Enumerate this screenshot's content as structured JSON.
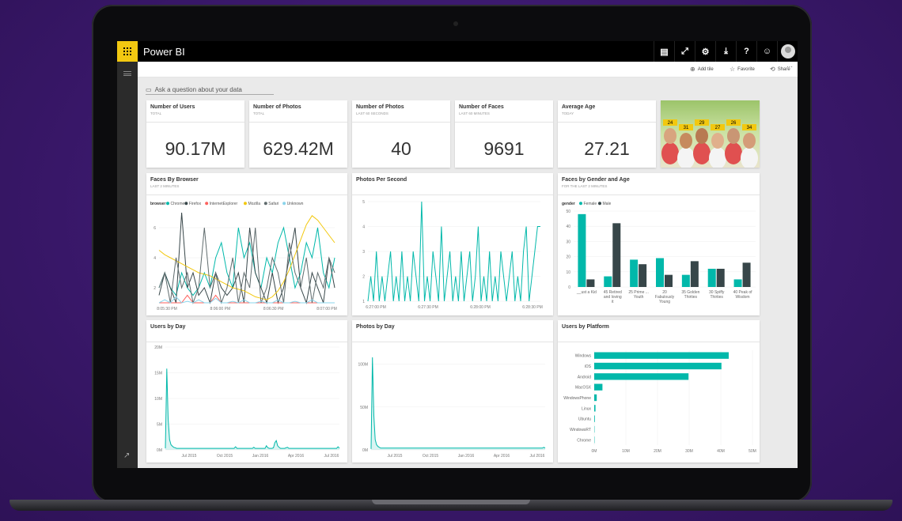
{
  "app": {
    "title": "Power BI"
  },
  "topbar_icons": [
    "comment-icon",
    "fullscreen-icon",
    "gear-icon",
    "download-icon",
    "help-icon",
    "smiley-icon"
  ],
  "topbar_glyphs": [
    "▤",
    "⤢",
    "⚙",
    "⤓",
    "?",
    "☺"
  ],
  "toolbar": {
    "add_tile": "Add tile",
    "favorite": "Favorite",
    "share": "Share",
    "more": "···"
  },
  "qna": {
    "placeholder": "Ask a question about your data"
  },
  "colors": {
    "teal": "#01b8aa",
    "dark": "#374649",
    "red": "#fd625e",
    "yellow": "#f2c80f",
    "gray": "#5f6b6d",
    "lightblue": "#8ad4eb",
    "accent": "#f2c811"
  },
  "cards": [
    {
      "title": "Number of Users",
      "subtitle": "TOTAL",
      "value": "90.17M"
    },
    {
      "title": "Number of Photos",
      "subtitle": "TOTAL",
      "value": "629.42M"
    },
    {
      "title": "Number of Photos",
      "subtitle": "LAST 60 SECONDS",
      "value": "40"
    },
    {
      "title": "Number of Faces",
      "subtitle": "LAST 60 MINUTES",
      "value": "9691"
    },
    {
      "title": "Average Age",
      "subtitle": "TODAY",
      "value": "27.21"
    }
  ],
  "photo": {
    "face_tags": [
      "24",
      "31",
      "29",
      "27",
      "26",
      "34"
    ]
  },
  "tiles": {
    "faces_by_browser": {
      "title": "Faces By Browser",
      "subtitle": "LAST 2 MINUTES"
    },
    "photos_per_second": {
      "title": "Photos Per Second"
    },
    "faces_by_gender": {
      "title": "Faces by Gender and Age",
      "subtitle": "FOR THE LAST 2 MINUTES"
    },
    "users_by_day": {
      "title": "Users by Day"
    },
    "photos_by_day": {
      "title": "Photos by Day"
    },
    "users_by_platform": {
      "title": "Users by Platform"
    }
  },
  "chart_data": [
    {
      "id": "faces_by_browser",
      "type": "line",
      "legend_title": "browser",
      "legend": [
        "Chrome",
        "Firefox",
        "InternetExplorer",
        "Mozilla",
        "Safari",
        "Unknown"
      ],
      "x_ticks": [
        "8:05:30 PM",
        "8:06:00 PM",
        "8:06:30 PM",
        "8:07:00 PM"
      ],
      "y_ticks": [
        2,
        4,
        6
      ],
      "ylim": [
        1,
        7
      ],
      "series": [
        {
          "name": "Chrome",
          "color": "#01b8aa",
          "values": [
            2,
            3,
            2,
            1.5,
            3,
            2,
            1.5,
            2,
            3,
            2,
            4,
            5,
            3,
            2,
            6,
            4,
            5,
            3,
            2,
            4,
            3,
            5,
            6,
            4,
            2,
            3,
            5,
            4,
            6,
            3,
            2,
            4
          ]
        },
        {
          "name": "Firefox",
          "color": "#374649",
          "values": [
            1.5,
            3,
            2,
            1,
            7,
            2,
            3,
            1.5,
            2,
            1,
            3,
            2,
            1.5,
            2,
            3,
            1,
            6,
            3,
            2,
            1,
            3,
            1,
            2,
            4,
            6,
            2,
            1,
            3,
            2,
            1,
            4,
            2
          ]
        },
        {
          "name": "InternetExplorer",
          "color": "#fd625e",
          "values": [
            1,
            1,
            1,
            1,
            1,
            1.5,
            1,
            1,
            1,
            1,
            1.5,
            1,
            1,
            1,
            1,
            1,
            1,
            1,
            1,
            1,
            1,
            1,
            1,
            1,
            1,
            1,
            1,
            1,
            1,
            1,
            1,
            1
          ]
        },
        {
          "name": "Mozilla",
          "color": "#f2c80f",
          "values": [
            4.5,
            4.2,
            4,
            3.8,
            3.6,
            3.4,
            3.2,
            3,
            2.9,
            2.8,
            2.6,
            2.4,
            2.2,
            2,
            1.9,
            1.8,
            1.6,
            1.4,
            1.3,
            1.2,
            1.4,
            1.8,
            2.4,
            3.2,
            4.2,
            5.2,
            6.2,
            6.8,
            6.5,
            6,
            5.5,
            5
          ]
        },
        {
          "name": "Safari",
          "color": "#5f6b6d",
          "values": [
            2,
            3,
            1,
            4,
            2,
            3,
            1,
            2,
            6,
            2,
            3,
            1,
            2,
            4,
            1,
            3,
            2,
            6,
            1,
            2,
            4,
            3,
            1,
            5,
            3,
            2,
            4,
            1,
            3,
            2,
            4,
            3
          ]
        },
        {
          "name": "Unknown",
          "color": "#8ad4eb",
          "values": [
            1,
            1.2,
            1,
            1.4,
            1,
            1.1,
            1,
            1.2,
            1,
            1,
            1.3,
            1,
            1,
            1.1,
            1,
            1.2,
            1,
            1,
            1.1,
            1,
            1,
            1.2,
            1,
            1,
            1.1,
            1,
            1,
            1.2,
            1,
            1,
            1,
            1
          ]
        }
      ]
    },
    {
      "id": "photos_per_second",
      "type": "line",
      "x_ticks": [
        "6:27:00 PM",
        "6:27:30 PM",
        "6:28:00 PM",
        "6:28:30 PM"
      ],
      "y_ticks": [
        1,
        2,
        3,
        4,
        5
      ],
      "ylim": [
        1,
        5
      ],
      "series": [
        {
          "name": "",
          "color": "#01b8aa",
          "values": [
            1,
            2,
            1,
            3,
            1,
            2,
            1,
            2,
            3,
            1,
            2,
            1,
            3,
            1,
            2,
            1,
            3,
            2,
            1,
            5,
            1,
            2,
            1,
            3,
            2,
            1,
            4,
            1,
            2,
            3,
            1,
            2,
            1,
            3,
            1,
            2,
            3,
            1,
            2,
            4,
            1,
            2,
            1,
            3,
            1,
            2,
            1,
            3,
            2,
            1,
            2,
            3,
            1,
            2,
            1,
            3,
            4,
            1,
            2,
            3,
            4,
            4
          ]
        }
      ]
    },
    {
      "id": "faces_by_gender",
      "type": "bar",
      "legend_title": "gender",
      "legend": [
        "Female",
        "Male"
      ],
      "categories": [
        "__ust a Kid",
        "45 Retired and loving it",
        "25 Prime ... Youth",
        "20 Fabulously Young",
        "35 Golden Thirties",
        "30 Spiffy Thirties",
        "40 Peak of Wisdom"
      ],
      "category_lines": [
        [
          "__ust a Kid"
        ],
        [
          "45 Retired",
          "and loving",
          "it"
        ],
        [
          "25 Prime ...",
          "Youth"
        ],
        [
          "20",
          "Fabulously",
          "Young"
        ],
        [
          "35 Golden",
          "Thirties"
        ],
        [
          "30 Spiffy",
          "Thirties"
        ],
        [
          "40 Peak of",
          "Wisdom"
        ]
      ],
      "y_ticks": [
        0,
        10,
        20,
        30,
        40,
        50
      ],
      "ylim": [
        0,
        50
      ],
      "series": [
        {
          "name": "Female",
          "color": "#01b8aa",
          "values": [
            48,
            7,
            18,
            19,
            8,
            12,
            5
          ]
        },
        {
          "name": "Male",
          "color": "#374649",
          "values": [
            5,
            42,
            15,
            8,
            17,
            12,
            16
          ]
        }
      ]
    },
    {
      "id": "users_by_day",
      "type": "area",
      "x_ticks": [
        "Jul 2015",
        "Oct 2015",
        "Jan 2016",
        "Apr 2016",
        "Jul 2016"
      ],
      "y_ticks": [
        "0M",
        "5M",
        "10M",
        "15M",
        "20M"
      ],
      "ylim": [
        0,
        20
      ],
      "series": [
        {
          "name": "",
          "color": "#01b8aa",
          "values": [
            0.3,
            15.8,
            6,
            2,
            1,
            0.7,
            0.5,
            0.4,
            0.3,
            0.3,
            0.3,
            0.3,
            0.3,
            0.3,
            0.3,
            0.3,
            0.3,
            0.3,
            0.3,
            0.3,
            0.3,
            0.3,
            0.3,
            0.3,
            0.3,
            0.3,
            0.3,
            0.3,
            0.3,
            0.3,
            0.3,
            0.3,
            0.3,
            0.3,
            0.3,
            0.3,
            0.3,
            0.3,
            0.3,
            0.3,
            0.3,
            0.3,
            0.3,
            0.3,
            0.3,
            0.3,
            0.3,
            0.3,
            0.3,
            0.3,
            0.6,
            0.3,
            0.3,
            0.3,
            0.3,
            0.3,
            0.3,
            0.3,
            0.3,
            0.3,
            0.3,
            0.3,
            0.3,
            0.5,
            0.3,
            0.3,
            0.3,
            0.3,
            0.3,
            0.3,
            0.3,
            0.3,
            0.8,
            0.4,
            0.3,
            0.3,
            0.3,
            0.4,
            1.4,
            1.8,
            0.8,
            0.5,
            0.3,
            0.3,
            0.3,
            0.3,
            0.4,
            0.5,
            0.3,
            0.3,
            0.3,
            0.3,
            0.3,
            0.3,
            0.3,
            0.3,
            0.3,
            0.3,
            0.3,
            0.3,
            0.3,
            0.3,
            0.3,
            0.3,
            0.3,
            0.3,
            0.3,
            0.3,
            0.3,
            0.3,
            0.3,
            0.3,
            0.3,
            0.3,
            0.3,
            0.3,
            0.3,
            0.3,
            0.3,
            0.3,
            0.3,
            0.3,
            0.3,
            0.6,
            0.3
          ]
        }
      ]
    },
    {
      "id": "photos_by_day",
      "type": "area",
      "x_ticks": [
        "Jul 2015",
        "Oct 2015",
        "Jan 2016",
        "Apr 2016",
        "Jul 2016"
      ],
      "y_ticks": [
        "0M",
        "50M",
        "100M"
      ],
      "ylim": [
        0,
        120
      ],
      "series": [
        {
          "name": "",
          "color": "#01b8aa",
          "values": [
            1,
            108,
            40,
            12,
            6,
            4,
            3,
            2,
            2,
            2,
            2,
            2,
            2,
            2,
            2,
            2,
            2,
            2,
            2,
            2,
            2,
            2,
            2,
            2,
            2,
            2,
            2,
            2,
            2,
            2,
            2,
            2,
            2,
            2,
            2,
            2,
            2,
            2,
            2,
            2,
            2,
            2,
            2,
            2,
            2,
            2,
            2,
            2,
            2,
            2,
            2,
            2,
            2,
            2,
            2,
            2,
            2,
            2,
            2,
            2,
            2,
            2,
            2,
            2,
            2,
            2,
            2,
            2,
            2,
            2,
            2,
            2,
            2,
            2,
            2,
            2,
            2,
            2,
            2,
            2,
            2,
            2,
            2,
            2,
            2,
            2,
            2,
            2,
            2,
            2,
            2,
            2,
            2,
            2,
            2,
            2,
            2,
            2,
            2,
            2,
            2,
            2,
            2,
            2,
            2,
            2,
            2,
            2,
            2,
            2,
            2,
            2,
            2,
            2,
            2,
            2,
            2,
            2,
            2,
            2,
            2,
            2,
            2,
            2,
            2,
            2,
            3,
            2
          ]
        }
      ]
    },
    {
      "id": "users_by_platform",
      "type": "bar",
      "orientation": "horizontal",
      "categories": [
        "Windows",
        "iOS",
        "Android",
        "MacOSX",
        "WindowsPhone",
        "Linux",
        "Ubuntu",
        "WindowsRT",
        "Chrome"
      ],
      "x_ticks": [
        "0M",
        "10M",
        "20M",
        "30M",
        "40M",
        "50M"
      ],
      "xlim": [
        0,
        50
      ],
      "series": [
        {
          "name": "",
          "color": "#01b8aa",
          "values": [
            42.5,
            40.2,
            29.8,
            2.6,
            0.8,
            0.4,
            0.2,
            0.1,
            0.1
          ]
        }
      ]
    }
  ]
}
